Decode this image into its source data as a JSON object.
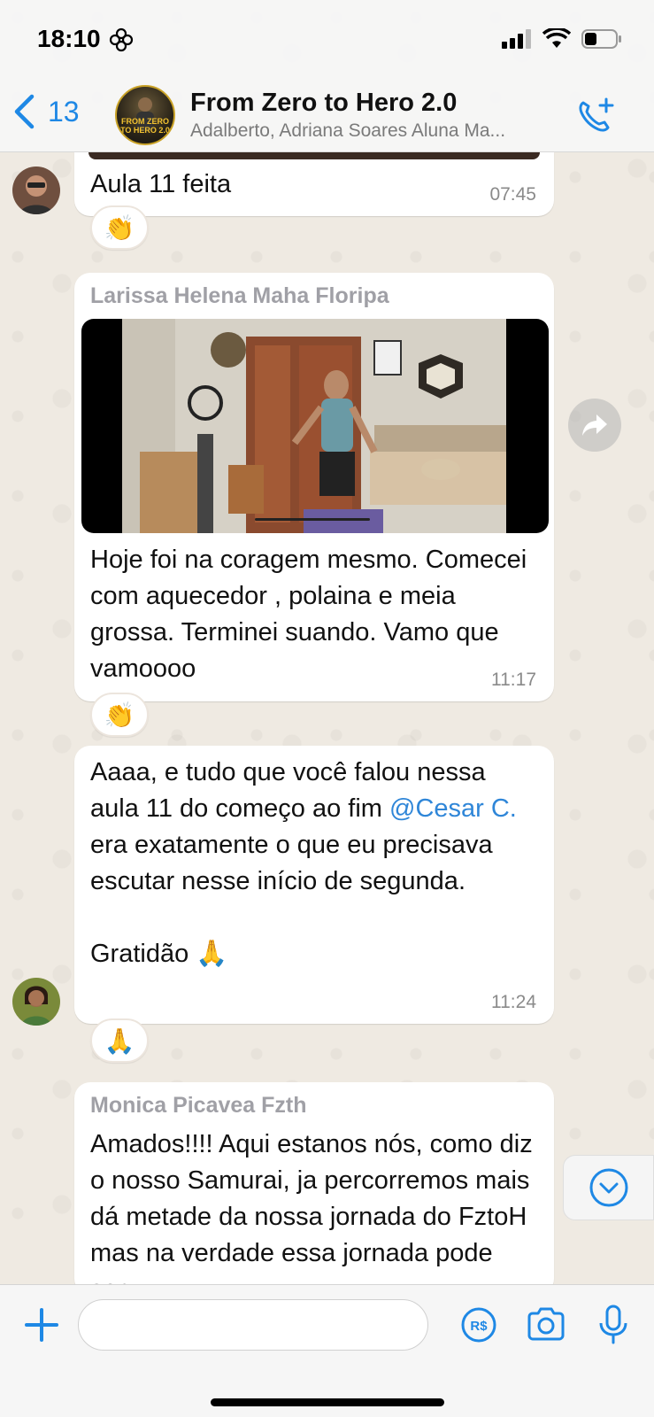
{
  "status_bar": {
    "time": "18:10"
  },
  "header": {
    "back_count": "13",
    "group_name": "From Zero to Hero 2.0",
    "group_avatar_text": "FROM ZERO TO HERO 2.0",
    "participants": "Adalberto, Adriana Soares Aluna Ma..."
  },
  "messages": [
    {
      "text": "Aula 11 feita",
      "time": "07:45",
      "reaction": "👏"
    },
    {
      "sender": "Larissa Helena Maha Floripa",
      "text": "Hoje foi na coragem mesmo. Comecei com aquecedor , polaina e meia grossa. Terminei suando. Vamo que vamoooo",
      "time": "11:17",
      "reaction": "👏"
    },
    {
      "text_before": "Aaaa, e tudo que você falou nessa aula 11 do começo ao fim ",
      "mention": "@Cesar C.",
      "text_after": " era exatamente o que eu precisava escutar nesse início de segunda.\n\nGratidão 🙏",
      "time": "11:24",
      "reaction": "🙏"
    },
    {
      "sender": "Monica Picavea Fzth",
      "text": "Amados!!!! Aqui estanos nós, como diz o nosso Samurai, ja percorremos mais dá metade da nossa jornada do FztoH mas na verdade essa jornada pode ser"
    }
  ],
  "composer": {
    "placeholder": ""
  },
  "colors": {
    "accent": "#1e88e5",
    "mention": "#2f86d8",
    "bubble": "#ffffff",
    "wallpaper": "#efeae2"
  }
}
